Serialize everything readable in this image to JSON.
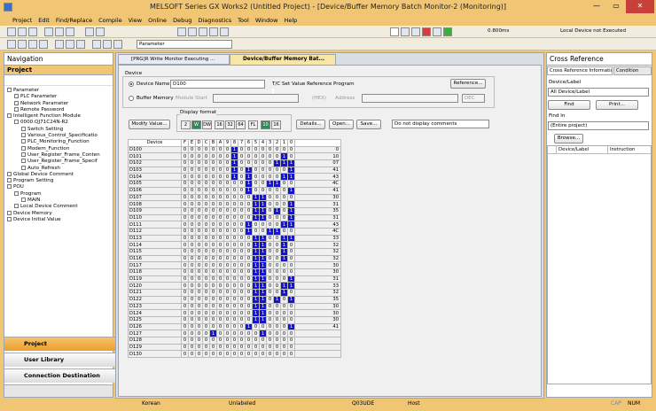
{
  "window": {
    "title": "MELSOFT Series GX Works2 (Untitled Project) - [Device/Buffer Memory Batch Monitor-2 (Monitoring)]",
    "min": "—",
    "max": "▭",
    "close": "✕"
  },
  "menu": [
    "Project",
    "Edit",
    "Find/Replace",
    "Compile",
    "View",
    "Online",
    "Debug",
    "Diagnostics",
    "Tool",
    "Window",
    "Help"
  ],
  "toolbar": {
    "scan_time": "0.800ms",
    "connection_status": "Local Device not Executed",
    "parameter_combo": "Parameter"
  },
  "tabs": [
    "[PRG]R Write Monitor Executing ...",
    "Device/Buffer Memory Bat..."
  ],
  "navigation": {
    "title": "Navigation",
    "project_header": "Project",
    "tree": [
      {
        "label": "Parameter",
        "depth": 0
      },
      {
        "label": "PLC Parameter",
        "depth": 1
      },
      {
        "label": "Network Parameter",
        "depth": 1
      },
      {
        "label": "Remote Password",
        "depth": 1
      },
      {
        "label": "Intelligent Function Module",
        "depth": 0
      },
      {
        "label": "0000:QJ71C24N-R2",
        "depth": 1
      },
      {
        "label": "Switch Setting",
        "depth": 2
      },
      {
        "label": "Various_Control_Specificatio",
        "depth": 2
      },
      {
        "label": "PLC_Monitoring_Function",
        "depth": 2
      },
      {
        "label": "Modem_Function",
        "depth": 2
      },
      {
        "label": "User_Register_Frame_Conten",
        "depth": 2
      },
      {
        "label": "User_Register_Frame_Specif",
        "depth": 2
      },
      {
        "label": "Auto_Refresh",
        "depth": 2
      },
      {
        "label": "Global Device Comment",
        "depth": 0
      },
      {
        "label": "Program Setting",
        "depth": 0
      },
      {
        "label": "POU",
        "depth": 0
      },
      {
        "label": "Program",
        "depth": 1
      },
      {
        "label": "MAIN",
        "depth": 2
      },
      {
        "label": "Local Device Comment",
        "depth": 1
      },
      {
        "label": "Device Memory",
        "depth": 0
      },
      {
        "label": "Device Initial Value",
        "depth": 0
      }
    ],
    "buttons": [
      "Project",
      "User Library",
      "Connection Destination"
    ]
  },
  "monitor": {
    "device_group": "Device",
    "device_name_label": "Device Name",
    "device_name_value": "D100",
    "tc_label": "T/C Set Value Reference Program",
    "reference_button": "Reference...",
    "buffer_memory_label": "Buffer Memory",
    "module_start_label": "Module Start",
    "hex_label": "(HEX)",
    "address_label": "Address",
    "dec_label": "DEC",
    "display_format_label": "Display format",
    "modify_button": "Modify Value...",
    "details_button": "Details...",
    "open_button": "Open...",
    "save_button": "Save...",
    "comment_combo": "Do not display comments",
    "format_buttons": [
      "2",
      "W",
      "DW",
      "16",
      "32",
      "64",
      "FL",
      "10",
      "16"
    ],
    "columns": [
      "Device",
      "F",
      "E",
      "D",
      "C",
      "B",
      "A",
      "9",
      "8",
      "7",
      "6",
      "5",
      "4",
      "3",
      "2",
      "1",
      "0",
      ""
    ],
    "rows": [
      [
        "D100",
        "0100"
      ],
      [
        "D101",
        "0102"
      ],
      [
        "D102",
        "0107"
      ],
      [
        "D103",
        "0141"
      ],
      [
        "D104",
        "0143"
      ],
      [
        "D105",
        "004C"
      ],
      [
        "D106",
        "0041"
      ],
      [
        "D107",
        "0030"
      ],
      [
        "D108",
        "0031"
      ],
      [
        "D109",
        "0035"
      ],
      [
        "D110",
        "0031"
      ],
      [
        "D111",
        "0043"
      ],
      [
        "D112",
        "004C"
      ],
      [
        "D113",
        "0033"
      ],
      [
        "D114",
        "0032"
      ],
      [
        "D115",
        "0032"
      ],
      [
        "D116",
        "0032"
      ],
      [
        "D117",
        "0030"
      ],
      [
        "D118",
        "0030"
      ],
      [
        "D119",
        "0031"
      ],
      [
        "D120",
        "0033"
      ],
      [
        "D121",
        "0032"
      ],
      [
        "D122",
        "0035"
      ],
      [
        "D123",
        "0030"
      ],
      [
        "D124",
        "0030"
      ],
      [
        "D125",
        "0030"
      ],
      [
        "D126",
        "0041"
      ],
      [
        "D127",
        "0810"
      ],
      [
        "D128",
        "0000"
      ],
      [
        "D129",
        "0000"
      ],
      [
        "D130",
        "0000"
      ]
    ],
    "values": [
      "0",
      "10",
      "07",
      "41",
      "43",
      "4C",
      "41",
      "30",
      "31",
      "35",
      "31",
      "43",
      "4C",
      "33",
      "32",
      "32",
      "32",
      "30",
      "30",
      "31",
      "33",
      "32",
      "35",
      "30",
      "30",
      "30",
      "41",
      "",
      "",
      "",
      ""
    ]
  },
  "cross_reference": {
    "title": "Cross Reference",
    "tab1": "Cross Reference Information",
    "tab2": "Condition",
    "device_label_title": "Device/Label",
    "device_label_value": "All Device/Label",
    "find_button": "Find",
    "print_button": "Print...",
    "find_in_label": "Find In",
    "find_in_value": "(Entire project)",
    "browse_button": "Browse...",
    "col1": "Device/Label",
    "col2": "Instruction"
  },
  "status": {
    "lang": "Korean",
    "label": "Unlabeled",
    "cpu": "Q03UDE",
    "host": "Host",
    "cap": "CAP",
    "num": "NUM"
  }
}
